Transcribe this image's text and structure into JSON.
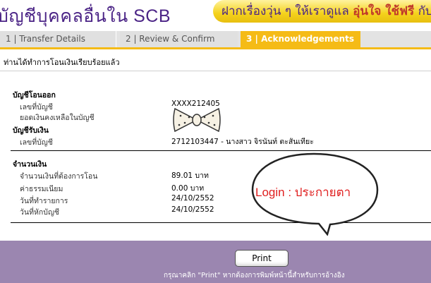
{
  "header": {
    "title": "บัญชีบุคคลอื่นใน SCB",
    "promo_text": "ฝากเรื่องวุ่น ๆ ให้เราดูแล",
    "promo_highlight": "อุ่นใจ ใช้ฟรี",
    "promo_suffix": "กับ S"
  },
  "tabs": [
    {
      "label": "1 | Transfer Details"
    },
    {
      "label": "2 | Review & Confirm"
    },
    {
      "label": "3 | Acknowledgements"
    }
  ],
  "notice": "ท่านได้ทำการโอนเงินเรียบร้อยแล้ว",
  "from_account": {
    "heading": "บัญชีโอนออก",
    "number_label": "เลขที่บัญชี",
    "number_value": "XXXX212405",
    "balance_label": "ยอดเงินคงเหลือในบัญชี"
  },
  "to_account": {
    "heading": "บัญชีรับเงิน",
    "number_label": "เลขที่บัญชี",
    "number_value": "2712103447 - นางสาว จิรนันท์ ตะสันเทียะ"
  },
  "amount": {
    "heading": "จำนวนเงิน",
    "rows": [
      {
        "label": "จำนวนเงินที่ต้องการโอน",
        "value": "89.01 บาท"
      },
      {
        "label": "ค่าธรรมเนียม",
        "value": "0.00 บาท"
      },
      {
        "label": "วันที่ทำรายการ",
        "value": "24/10/2552"
      },
      {
        "label": "วันที่หักบัญชี",
        "value": "24/10/2552"
      }
    ]
  },
  "overlay": {
    "bubble_text": "Login : ประกายตา",
    "bubble_color": "#e02020"
  },
  "footer": {
    "print_label": "Print",
    "hint": "กรุณาคลิก \"Print\" หากต้องการพิมพ์หน้านี้สำหรับการอ้างอิง"
  },
  "colors": {
    "brand_purple": "#4b2486",
    "tab_active": "#f5bb16",
    "footer_bg": "#9b86b0"
  }
}
